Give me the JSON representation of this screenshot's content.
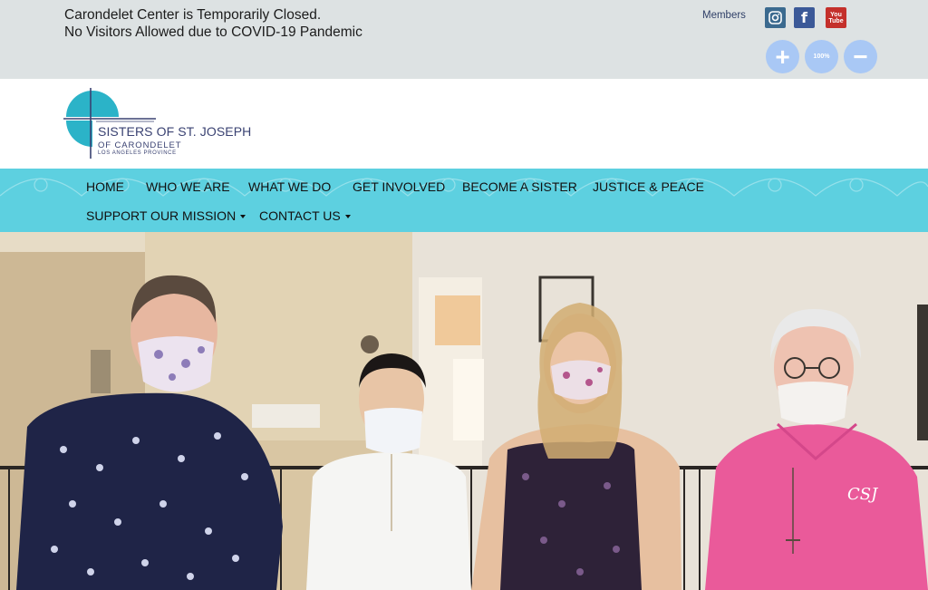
{
  "notice": {
    "line1": "Carondelet Center is Temporarily Closed.",
    "line2": "No Visitors Allowed due to COVID-19 Pandemic"
  },
  "topbar": {
    "members_label": "Members",
    "social": [
      {
        "name": "instagram-icon",
        "color": "#3b6a8f"
      },
      {
        "name": "facebook-icon",
        "label": "f",
        "color": "#3b5998"
      },
      {
        "name": "youtube-icon",
        "label_top": "You",
        "label_bottom": "Tube",
        "color": "#c4302b"
      }
    ],
    "zoom": {
      "plus": "+",
      "level": "100%",
      "minus": "−"
    }
  },
  "logo": {
    "line1": "SISTERS OF ST. JOSEPH",
    "line2": "OF CARONDELET",
    "line3": "LOS ANGELES PROVINCE",
    "accent_color": "#2bb3c8"
  },
  "nav": {
    "items": [
      {
        "label": "HOME"
      },
      {
        "label": "WHO WE ARE"
      },
      {
        "label": "WHAT WE DO"
      },
      {
        "label": "GET INVOLVED"
      },
      {
        "label": "BECOME A SISTER"
      },
      {
        "label": "JUSTICE & PEACE"
      },
      {
        "label": "SUPPORT OUR MISSION",
        "dropdown": true
      },
      {
        "label": "CONTACT US",
        "dropdown": true
      }
    ],
    "background": "#5dd0e0"
  },
  "hero": {
    "shirt_monogram": "CSJ"
  }
}
